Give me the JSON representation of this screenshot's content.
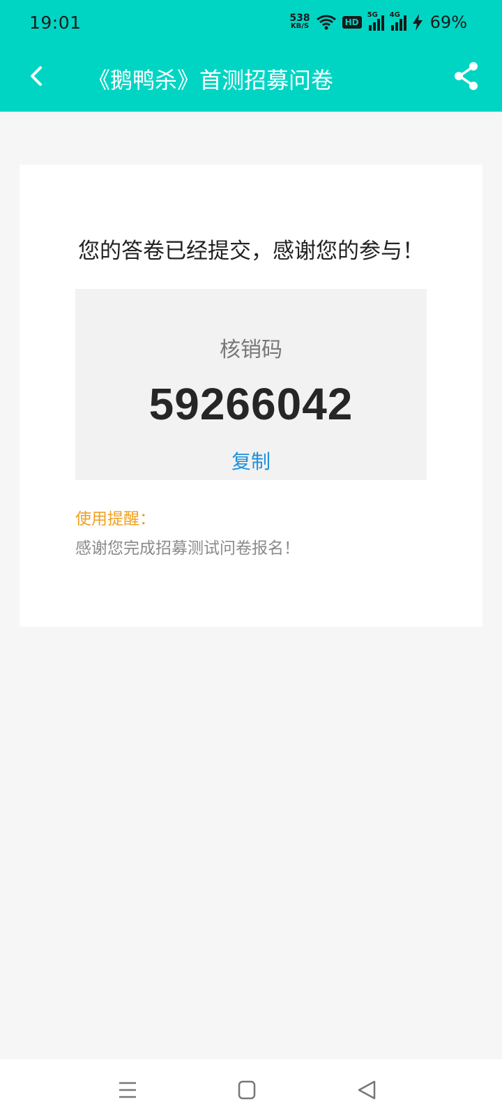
{
  "status_bar": {
    "time": "19:01",
    "net_speed_value": "538",
    "net_speed_unit": "KB/S",
    "hd_label": "HD",
    "sim1_label": "5G",
    "sim2_label": "4G",
    "battery": "69%"
  },
  "nav": {
    "title": "《鹅鸭杀》首测招募问卷",
    "back_icon": "chevron-left-icon",
    "share_icon": "share-icon"
  },
  "result": {
    "message": "您的答卷已经提交，感谢您的参与！",
    "code_label": "核销码",
    "code_value": "59266042",
    "copy_label": "复制",
    "tip_title": "使用提醒：",
    "tip_text": "感谢您完成招募测试问卷报名！"
  },
  "system_nav": {
    "menu_icon": "menu-icon",
    "home_icon": "home-icon",
    "back_icon": "triangle-back-icon"
  },
  "colors": {
    "header": "#00d5c4",
    "background": "#f6f6f6",
    "copy_link": "#1f8fdc",
    "tip_title": "#f0a020"
  }
}
